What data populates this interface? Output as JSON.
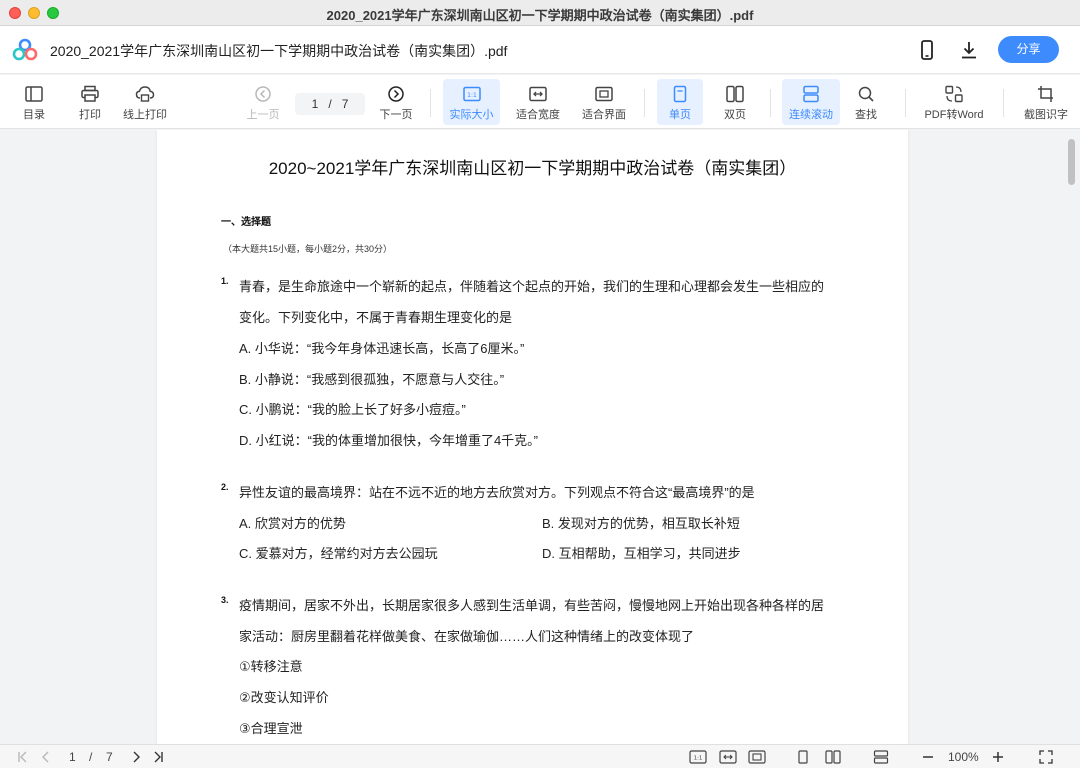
{
  "window": {
    "title": "2020_2021学年广东深圳南山区初一下学期期中政治试卷（南实集团）.pdf"
  },
  "header": {
    "doc_title": "2020_2021学年广东深圳南山区初一下学期期中政治试卷（南实集团）.pdf",
    "share_label": "分享",
    "icons": [
      "app-logo-icon",
      "phone-icon",
      "download-icon"
    ]
  },
  "toolbar": {
    "toc": "目录",
    "print": "打印",
    "online_print": "线上打印",
    "prev_page": "上一页",
    "page_current": "1",
    "page_sep": "/",
    "page_total": "7",
    "next_page": "下一页",
    "actual_size": "实际大小",
    "fit_width": "适合宽度",
    "fit_page": "适合界面",
    "single_page": "单页",
    "double_page": "双页",
    "continuous": "连续滚动",
    "search": "查找",
    "pdf_to_word": "PDF转Word",
    "ocr": "截图识字",
    "accent_color": "#3d8bfd"
  },
  "document": {
    "title": "2020~2021学年广东深圳南山区初一下学期期中政治试卷（南实集团）",
    "section_title": "一、选择题",
    "section_note": "（本大题共15小题，每小题2分，共30分）",
    "q1": {
      "num": "1.",
      "line1": "青春，是生命旅途中一个崭新的起点，伴随着这个起点的开始，我们的生理和心理都会发生一些相应的",
      "line2": "变化。下列变化中，不属于青春期生理变化的是",
      "a": "A. 小华说：“我今年身体迅速长高，长高了6厘米。”",
      "b": "B. 小静说：“我感到很孤独，不愿意与人交往。”",
      "c": "C. 小鹏说：“我的脸上长了好多小痘痘。”",
      "d": "D. 小红说：“我的体重增加很快，今年增重了4千克。”"
    },
    "q2": {
      "num": "2.",
      "line1": "异性友谊的最高境界：站在不远不近的地方去欣赏对方。下列观点不符合这“最高境界”的是",
      "a": "A. 欣赏对方的优势",
      "b": "B. 发现对方的优势，相互取长补短",
      "c": "C. 爱慕对方，经常约对方去公园玩",
      "d": "D. 互相帮助，互相学习，共同进步"
    },
    "q3": {
      "num": "3.",
      "line1": "疫情期间，居家不外出，长期居家很多人感到生活单调，有些苦闷，慢慢地网上开始出现各种各样的居",
      "line2": "家活动：厨房里翻着花样做美食、在家做瑜伽……人们这种情绪上的改变体现了",
      "o1": "①转移注意",
      "o2": "②改变认知评价",
      "o3": "③合理宣泄"
    }
  },
  "statusbar": {
    "page_current": "1",
    "page_sep": "/",
    "page_total": "7",
    "zoom": "100%"
  }
}
